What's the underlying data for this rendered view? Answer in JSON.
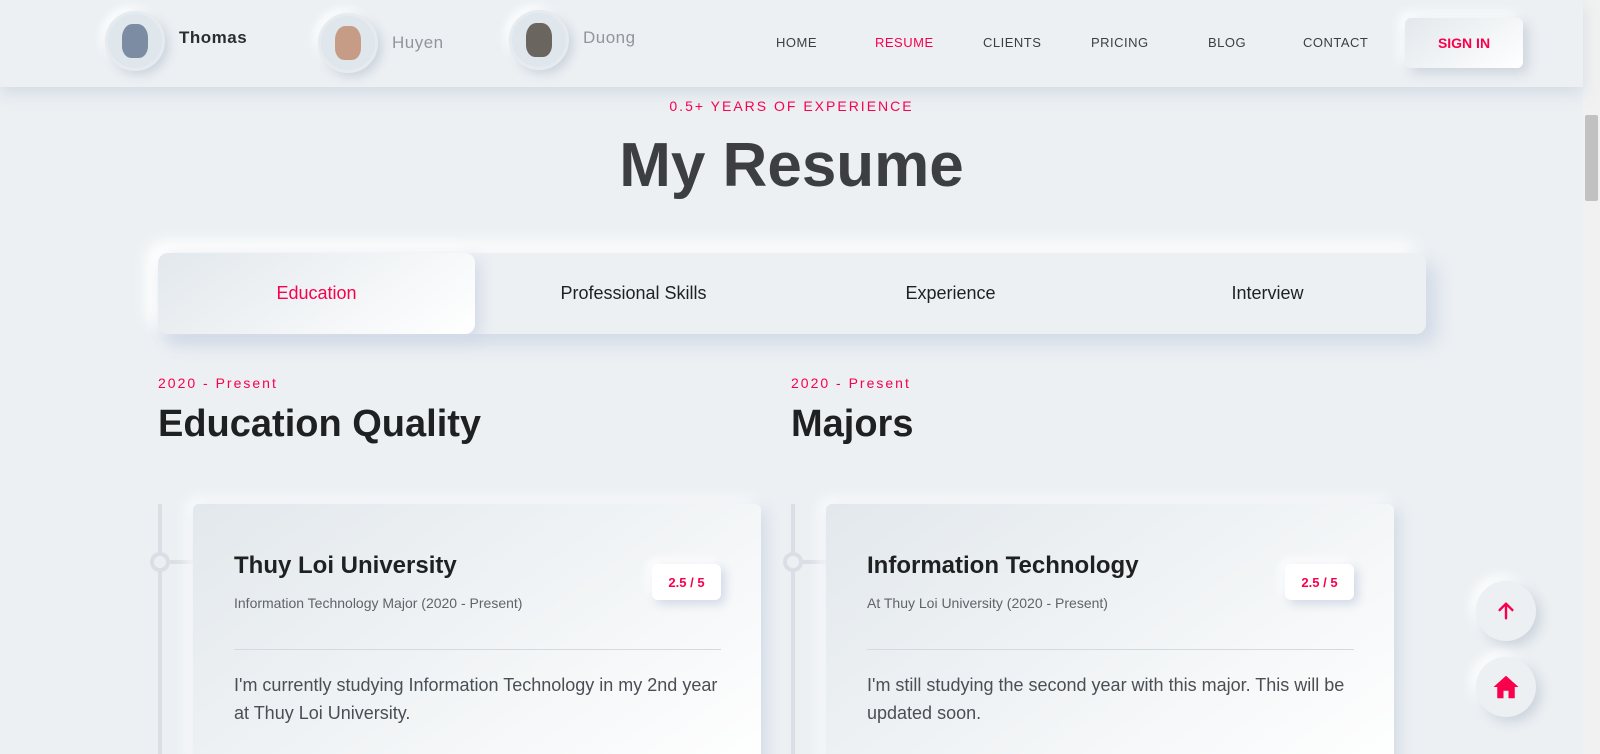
{
  "header": {
    "profiles": [
      {
        "name": "Thomas"
      },
      {
        "name": "Huyen"
      },
      {
        "name": "Duong"
      }
    ],
    "nav": [
      {
        "label": "HOME",
        "active": false
      },
      {
        "label": "RESUME",
        "active": true
      },
      {
        "label": "CLIENTS",
        "active": false
      },
      {
        "label": "PRICING",
        "active": false
      },
      {
        "label": "BLOG",
        "active": false
      },
      {
        "label": "CONTACT",
        "active": false
      }
    ],
    "signin_label": "SIGN IN"
  },
  "section": {
    "subtitle": "0.5+ YEARS OF EXPERIENCE",
    "title": "My Resume"
  },
  "tabs": [
    {
      "label": "Education",
      "active": true
    },
    {
      "label": "Professional Skills",
      "active": false
    },
    {
      "label": "Experience",
      "active": false
    },
    {
      "label": "Interview",
      "active": false
    }
  ],
  "columns": {
    "left": {
      "period": "2020 - Present",
      "title": "Education Quality",
      "card": {
        "title": "Thuy Loi University",
        "subtitle": "Information Technology Major (2020 - Present)",
        "rating": "2.5 / 5",
        "description": "I'm currently studying Information Technology in my 2nd year at Thuy Loi University."
      }
    },
    "right": {
      "period": "2020 - Present",
      "title": "Majors",
      "card": {
        "title": "Information Technology",
        "subtitle": "At Thuy Loi University (2020 - Present)",
        "rating": "2.5 / 5",
        "description": "I'm still studying the second year with this major. This will be updated soon."
      }
    }
  },
  "floating": {
    "up_icon": "arrow-up-icon",
    "home_icon": "home-icon"
  },
  "colors": {
    "accent": "#f9004d",
    "background": "#ecf0f3",
    "text": "#3c3e41"
  }
}
